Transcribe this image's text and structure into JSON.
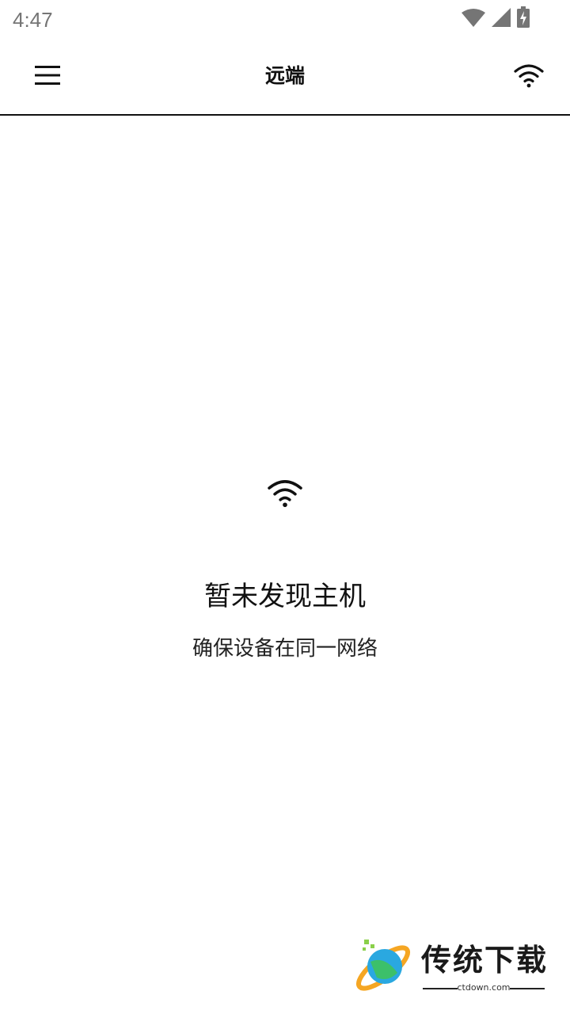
{
  "status_bar": {
    "time": "4:47",
    "icons": [
      "wifi-signal-icon",
      "cellular-signal-icon",
      "battery-charging-icon"
    ]
  },
  "app_bar": {
    "title": "远端",
    "left_icon": "menu-icon",
    "right_icon": "wifi-icon"
  },
  "empty_state": {
    "icon": "wifi-icon",
    "title": "暂未发现主机",
    "subtitle": "确保设备在同一网络"
  },
  "watermark": {
    "brand": "传统下载",
    "domain": "ctdown.com"
  },
  "colors": {
    "background": "#ffffff",
    "text_primary": "#111111",
    "status_text": "#757575",
    "divider": "#111111"
  }
}
